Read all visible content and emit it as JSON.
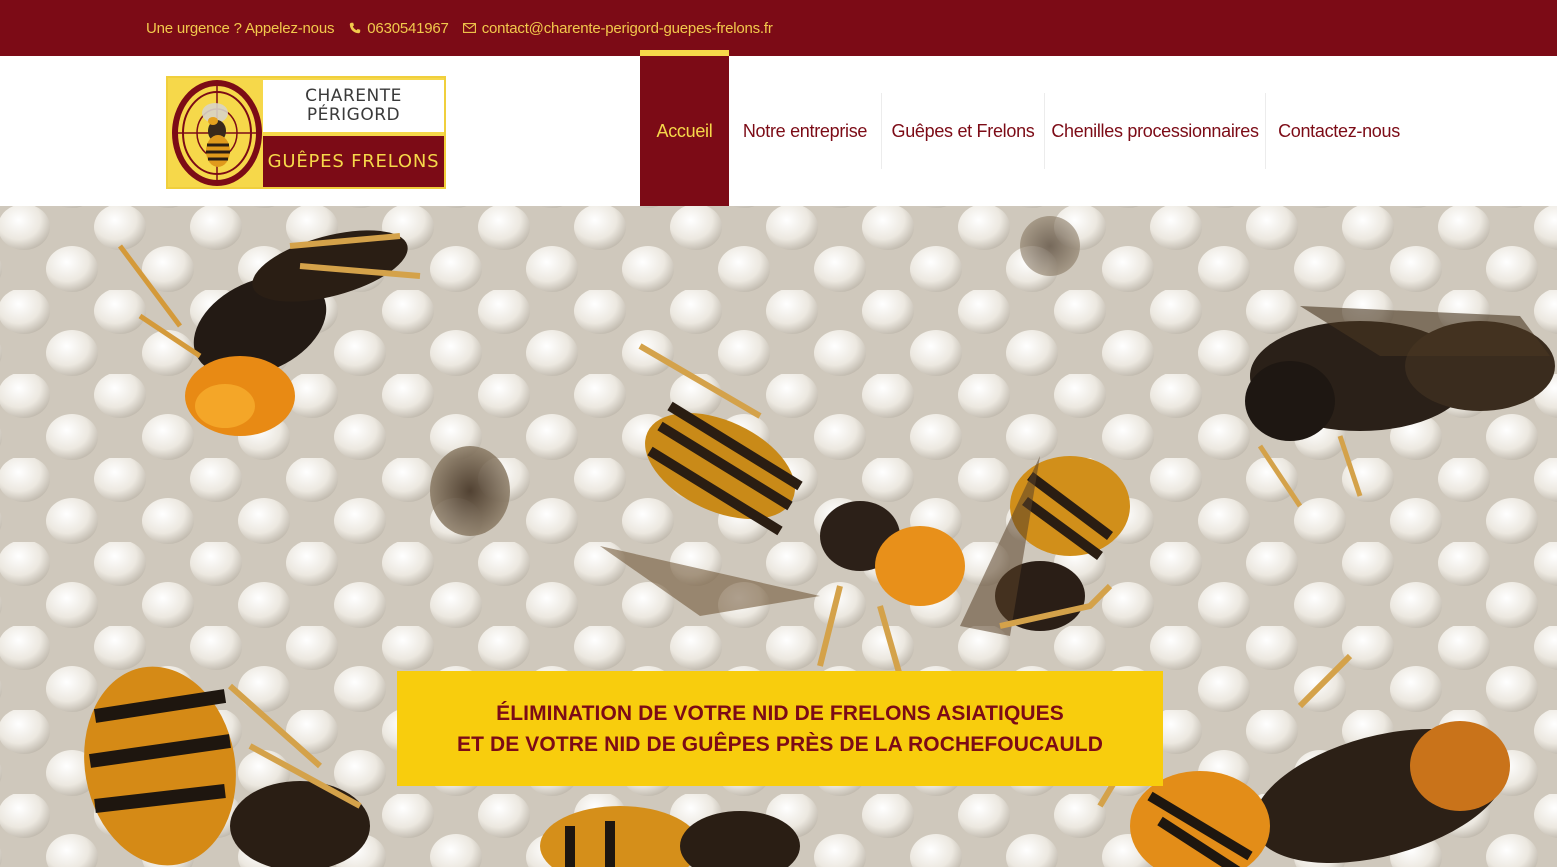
{
  "topbar": {
    "urgent_text": "Une urgence ? Appelez-nous",
    "phone": "0630541967",
    "email": "contact@charente-perigord-guepes-frelons.fr"
  },
  "logo": {
    "line1": "CHARENTE",
    "line2": "PÉRIGORD",
    "line3": "GUÊPES FRELONS"
  },
  "nav": {
    "items": [
      {
        "label": "Accueil",
        "active": true
      },
      {
        "label": "Notre entreprise",
        "active": false
      },
      {
        "label": "Guêpes et Frelons",
        "active": false
      },
      {
        "label": "Chenilles processionnaires",
        "active": false
      },
      {
        "label": "Contactez-nous",
        "active": false
      }
    ]
  },
  "hero": {
    "line1": "ÉLIMINATION DE VOTRE NID DE FRELONS ASIATIQUES",
    "line2": "ET DE VOTRE NID DE GUÊPES PRÈS DE LA ROCHEFOUCAULD"
  },
  "colors": {
    "brand_red": "#7c0b16",
    "brand_yellow": "#f8cd0d",
    "topbar_text": "#f2c94c"
  }
}
